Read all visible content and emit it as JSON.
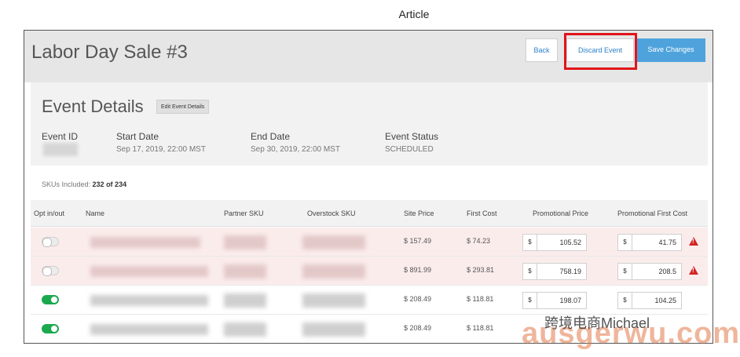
{
  "caption": "Article",
  "header": {
    "title": "Labor Day Sale #3",
    "back_label": "Back",
    "discard_label": "Discard Event",
    "save_label": "Save Changes"
  },
  "details": {
    "title": "Event Details",
    "edit_label": "Edit Event Details",
    "event_id_label": "Event ID",
    "start_label": "Start Date",
    "start_value": "Sep 17, 2019, 22:00 MST",
    "end_label": "End Date",
    "end_value": "Sep 30, 2019, 22:00 MST",
    "status_label": "Event Status",
    "status_value": "SCHEDULED"
  },
  "skus": {
    "prefix": "SKUs Included: ",
    "count": "232 of 234"
  },
  "table": {
    "headers": {
      "opt": "Opt in/out",
      "name": "Name",
      "partner_sku": "Partner SKU",
      "overstock_sku": "Overstock SKU",
      "site_price": "Site Price",
      "first_cost": "First Cost",
      "promo_price": "Promotional Price",
      "promo_first_cost": "Promotional First Cost"
    },
    "currency": "$",
    "rows": [
      {
        "opt_in": false,
        "site_price": "$ 157.49",
        "first_cost": "$ 74.23",
        "promo_price": "105.52",
        "promo_first_cost": "41.75",
        "warning": true
      },
      {
        "opt_in": false,
        "site_price": "$ 891.99",
        "first_cost": "$ 293.81",
        "promo_price": "758.19",
        "promo_first_cost": "208.5",
        "warning": true
      },
      {
        "opt_in": true,
        "site_price": "$ 208.49",
        "first_cost": "$ 118.81",
        "promo_price": "198.07",
        "promo_first_cost": "104.25",
        "warning": false
      },
      {
        "opt_in": true,
        "site_price": "$ 208.49",
        "first_cost": "$ 118.81",
        "promo_price": "",
        "promo_first_cost": "",
        "warning": false
      }
    ]
  },
  "watermark": {
    "text": "跨境电商Michael",
    "domain": "ausgerwu.com"
  },
  "colors": {
    "accent": "#4fa3dc",
    "highlight": "#e0141a",
    "toggle_on": "#1aa84f",
    "warning": "#d32424"
  }
}
